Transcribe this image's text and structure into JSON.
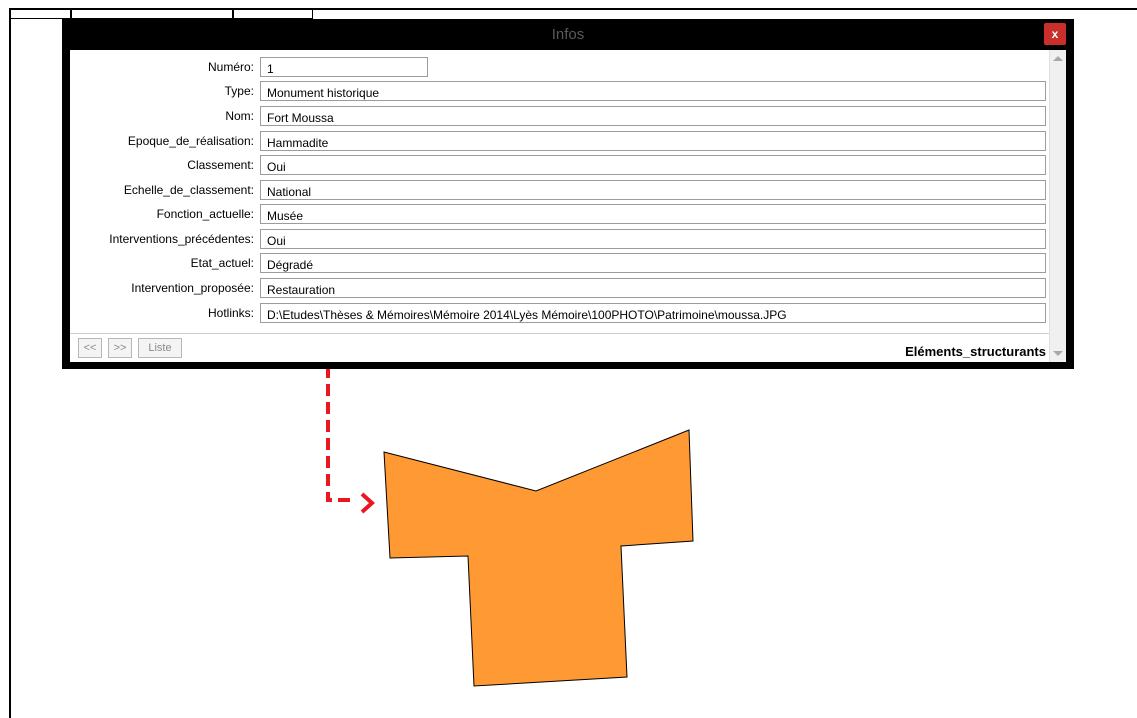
{
  "window": {
    "title": "Infos",
    "close_label": "x"
  },
  "fields": [
    {
      "label": "Numéro:",
      "value": "1"
    },
    {
      "label": "Type:",
      "value": "Monument historique"
    },
    {
      "label": "Nom:",
      "value": "Fort Moussa"
    },
    {
      "label": "Epoque_de_réalisation:",
      "value": "Hammadite"
    },
    {
      "label": "Classement:",
      "value": "Oui"
    },
    {
      "label": "Echelle_de_classement:",
      "value": "National"
    },
    {
      "label": "Fonction_actuelle:",
      "value": "Musée"
    },
    {
      "label": "Interventions_précédentes:",
      "value": "Oui"
    },
    {
      "label": "Etat_actuel:",
      "value": "Dégradé"
    },
    {
      "label": "Intervention_proposée:",
      "value": "Restauration"
    },
    {
      "label": "Hotlinks:",
      "value": "D:\\Etudes\\Thèses & Mémoires\\Mémoire 2014\\Lyès Mémoire\\100PHOTO\\Patrimoine\\moussa.JPG"
    }
  ],
  "nav": {
    "prev_label": "<<",
    "next_label": ">>",
    "list_label": "Liste",
    "layer_name": "Eléments_structurants"
  },
  "colors": {
    "feature_fill": "#ff9933",
    "arrow": "#e8181e",
    "close_button": "#c9302c"
  }
}
